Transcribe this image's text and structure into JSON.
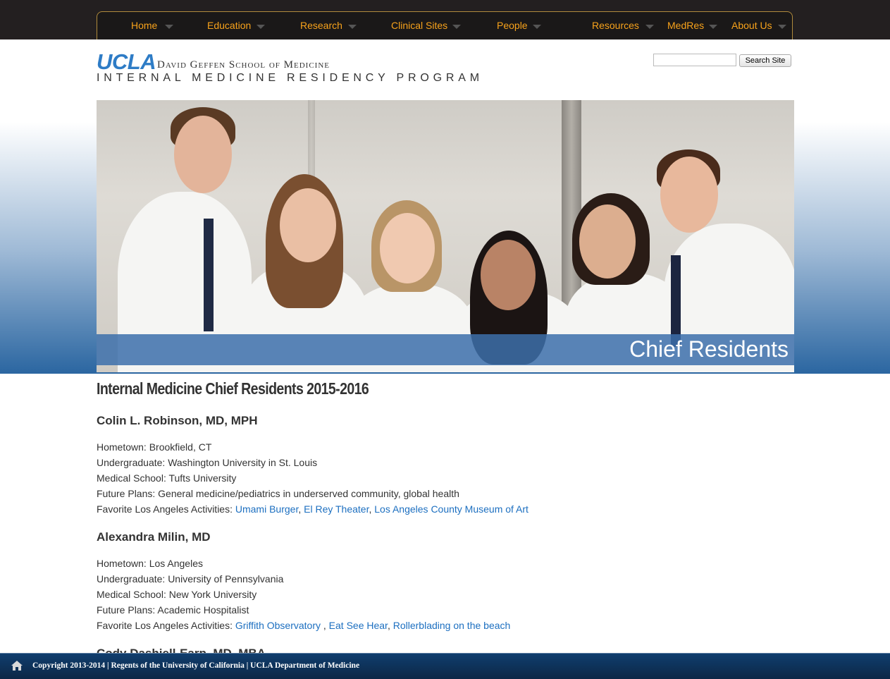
{
  "nav": {
    "items": [
      {
        "label": "Home"
      },
      {
        "label": "Education"
      },
      {
        "label": "Research"
      },
      {
        "label": "Clinical Sites"
      },
      {
        "label": "People"
      },
      {
        "label": "Resources"
      },
      {
        "label": "MedRes"
      },
      {
        "label": "About Us"
      }
    ]
  },
  "header": {
    "logo_ucla": "UCLA",
    "logo_school": "David Geffen School of Medicine",
    "logo_program": "INTERNAL MEDICINE RESIDENCY PROGRAM",
    "search_placeholder": "",
    "search_button": "Search Site"
  },
  "hero": {
    "caption": "Chief Residents"
  },
  "main": {
    "title": "Internal Medicine Chief Residents 2015-2016",
    "residents": [
      {
        "name": "Colin L. Robinson, MD, MPH",
        "hometown_label": "Hometown: ",
        "hometown": "Brookfield, CT",
        "undergrad_label": "Undergraduate: ",
        "undergrad": "Washington University in St. Louis",
        "medschool_label": "Medical School: ",
        "medschool": "Tufts University",
        "plans_label": "Future Plans: ",
        "plans": "General medicine/pediatrics in underserved community, global health",
        "activities_label": "Favorite Los Angeles Activities: ",
        "activities": [
          "Umami Burger",
          "El Rey Theater",
          "Los Angeles County Museum of Art"
        ],
        "activity_seps": [
          ", ",
          ", "
        ]
      },
      {
        "name": "Alexandra Milin, MD",
        "hometown_label": "Hometown: ",
        "hometown": "Los Angeles",
        "undergrad_label": "Undergraduate: ",
        "undergrad": "University of Pennsylvania",
        "medschool_label": "Medical School: ",
        "medschool": "New York University",
        "plans_label": "Future Plans: ",
        "plans": "Academic Hospitalist",
        "activities_label": "Favorite Los Angeles Activities: ",
        "activities": [
          "Griffith Observatory",
          "Eat See Hear",
          "Rollerblading on the beach"
        ],
        "activity_seps": [
          " , ",
          ", "
        ]
      },
      {
        "name": "Cody Dashiell-Earp, MD, MBA"
      }
    ]
  },
  "footer": {
    "text": "Copyright 2013-2014 | Regents of the University of California | UCLA Department of Medicine"
  },
  "colors": {
    "nav_text": "#f7a21b",
    "link": "#1c6fc0",
    "footer_bg": "#0c2746",
    "logo_blue": "#2e7cc6"
  }
}
